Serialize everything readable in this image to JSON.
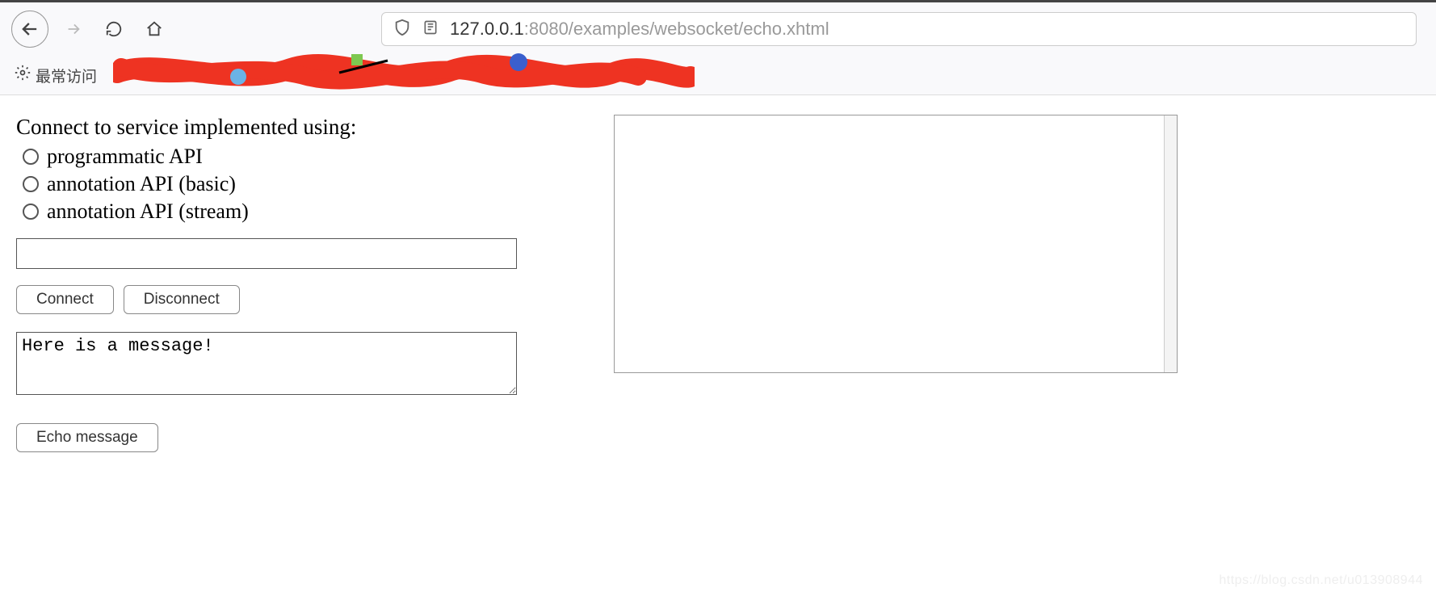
{
  "url": {
    "host": "127.0.0.1",
    "port_path": ":8080/examples/websocket/echo.xhtml"
  },
  "bookmarks": {
    "frequent": "最常访问"
  },
  "form": {
    "heading": "Connect to service implemented using:",
    "options": [
      "programmatic API",
      "annotation API (basic)",
      "annotation API (stream)"
    ],
    "input_value": "",
    "connect_label": "Connect",
    "disconnect_label": "Disconnect",
    "message_value": "Here is a message!",
    "echo_label": "Echo message"
  },
  "watermark": "https://blog.csdn.net/u013908944"
}
